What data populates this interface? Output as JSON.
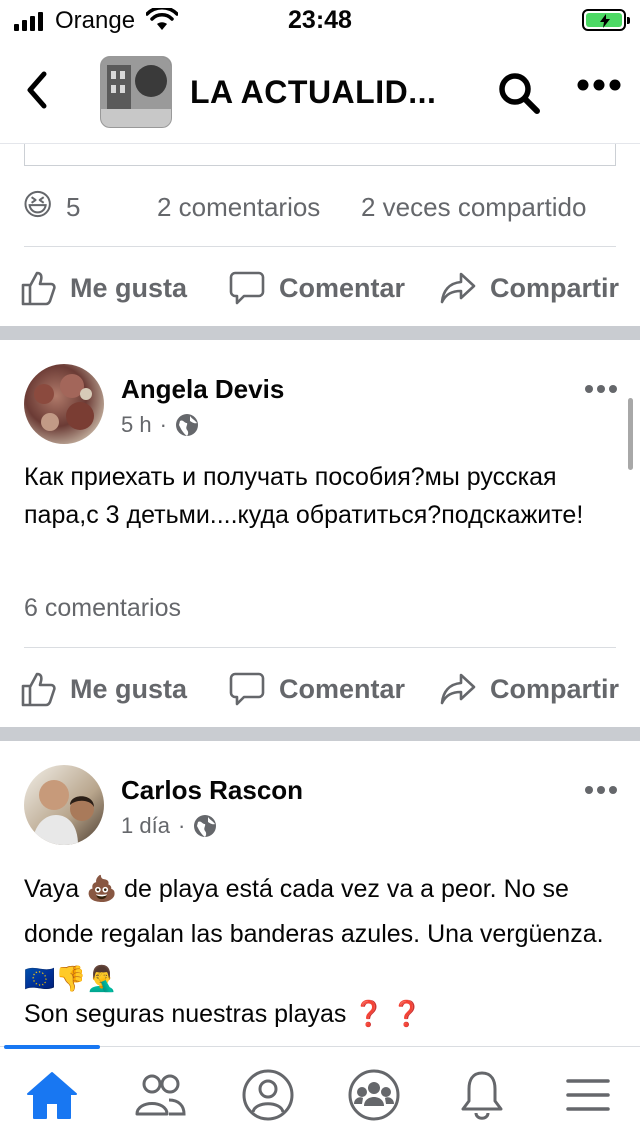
{
  "status_bar": {
    "carrier": "Orange",
    "time": "23:48",
    "battery_charging": true
  },
  "header": {
    "title": "LA ACTUALID...",
    "back_icon": "chevron-left-icon",
    "search_icon": "search-icon",
    "more_icon": "more-horizontal-icon"
  },
  "post1_footer": {
    "reaction_emoji": "😆",
    "reaction_count": "5",
    "comments": "2 comentarios",
    "shares": "2 veces compartido"
  },
  "actions": {
    "like": "Me gusta",
    "comment": "Comentar",
    "share": "Compartir"
  },
  "posts": [
    {
      "author": "Angela Devis",
      "time": "5 h",
      "separator": "·",
      "text": "Как приехать и получать пособия?мы русская пара,с 3 детьми....куда обратиться?подскажите!",
      "comments": "6 comentarios"
    },
    {
      "author": "Carlos Rascon",
      "time": "1 día",
      "separator": "·",
      "text_line1": "Vaya 💩 de playa está cada vez va a peor. No se donde regalan las banderas azules. Una vergüenza. 🇪🇺👎🤦‍♂️",
      "text_line2": "Son seguras nuestras playas ❓ ❓"
    }
  ],
  "tabbar": {
    "items": [
      "home-icon",
      "friends-icon",
      "profile-icon",
      "groups-icon",
      "notifications-icon",
      "menu-icon"
    ],
    "active": "home-icon",
    "accent": "#1877f2"
  }
}
